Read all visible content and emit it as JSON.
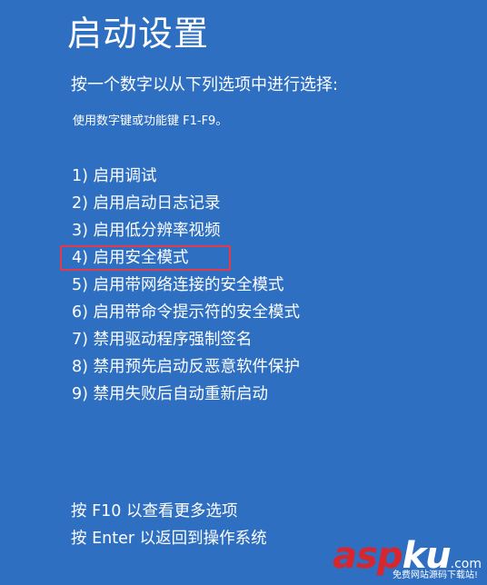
{
  "screen": {
    "title": "启动设置",
    "instruction": "按一个数字以从下列选项中进行选择:",
    "hint": "使用数字键或功能键 F1-F9。"
  },
  "options": [
    {
      "label": "1) 启用调试"
    },
    {
      "label": "2) 启用启动日志记录"
    },
    {
      "label": "3) 启用低分辨率视频"
    },
    {
      "label": "4) 启用安全模式",
      "highlighted": true
    },
    {
      "label": "5) 启用带网络连接的安全模式"
    },
    {
      "label": "6) 启用带命令提示符的安全模式"
    },
    {
      "label": "7) 禁用驱动程序强制签名"
    },
    {
      "label": "8) 禁用预先启动反恶意软件保护"
    },
    {
      "label": "9) 禁用失败后自动重新启动"
    }
  ],
  "footer": {
    "more_options": "按 F10 以查看更多选项",
    "return": "按 Enter 以返回到操作系统"
  },
  "watermark": {
    "logo_red": "asp",
    "logo_white": "ku",
    "logo_suffix": ".com",
    "tagline": "免费网站源码下载站!"
  },
  "colors": {
    "background": "#2e6fc1",
    "text": "#ffffff",
    "highlight_border": "#e23a4a",
    "watermark_red": "#d8262e"
  }
}
